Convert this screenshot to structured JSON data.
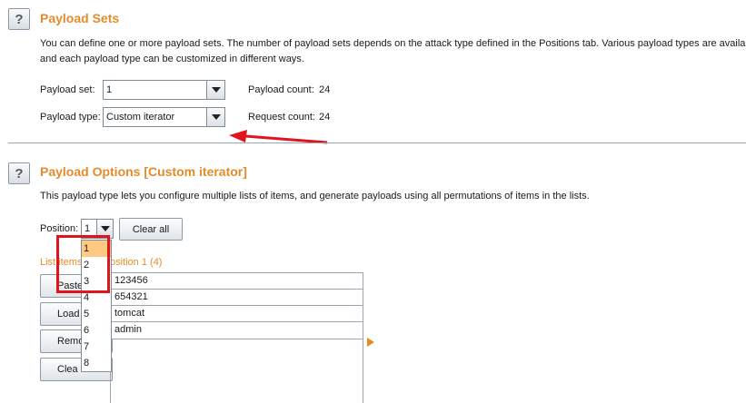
{
  "payload_sets": {
    "title": "Payload Sets",
    "description_line1": "You can define one or more payload sets. The number of payload sets depends on the attack type defined in the Positions tab. Various payload types are availab",
    "description_line2": "and each payload type can be customized in different ways.",
    "payload_set_label": "Payload set:",
    "payload_set_value": "1",
    "payload_type_label": "Payload type:",
    "payload_type_value": "Custom iterator",
    "payload_count_label": "Payload count:",
    "payload_count_value": "24",
    "request_count_label": "Request count:",
    "request_count_value": "24"
  },
  "payload_options": {
    "title": "Payload Options [Custom iterator]",
    "description": "This payload type lets you configure multiple lists of items, and generate payloads using all permutations of items in the lists.",
    "position_label": "Position:",
    "position_value": "1",
    "clear_all_label": "Clear all",
    "list_header_left": "List items",
    "list_header_right": "osition 1 (4)",
    "buttons": [
      "Paste",
      "Load",
      "Remo",
      "Clea"
    ],
    "list_items": [
      "123456",
      "654321",
      "tomcat",
      "admin"
    ]
  },
  "position_dropdown": {
    "options": [
      "1",
      "2",
      "3",
      "4",
      "5",
      "6",
      "7",
      "8"
    ],
    "selected": "1"
  },
  "colors": {
    "accent_orange": "#e38b2a",
    "annotation_red": "#e0141c",
    "selection_highlight": "#ffc982"
  },
  "icons": {
    "help": "help-icon",
    "dropdown": "chevron-down-icon",
    "add_item": "triangle-right-icon"
  }
}
